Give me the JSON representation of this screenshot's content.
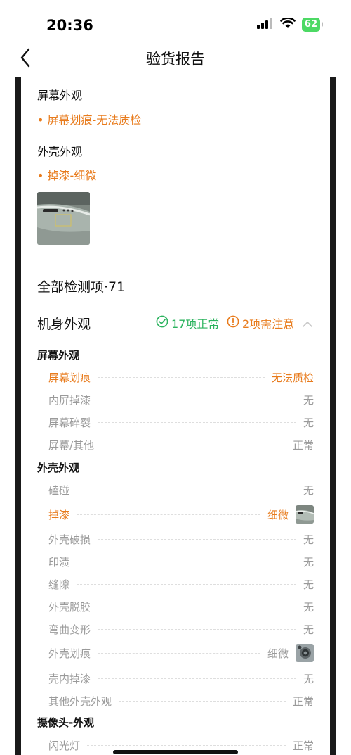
{
  "status": {
    "time": "20:36",
    "battery": "62"
  },
  "nav": {
    "title": "验货报告"
  },
  "issues": [
    {
      "heading": "屏幕外观",
      "item": "• 屏幕划痕-无法质检"
    },
    {
      "heading": "外壳外观",
      "item": "• 掉漆-细微"
    }
  ],
  "all_items_title": "全部检测项·71",
  "section": {
    "title": "机身外观",
    "ok_badge": "17项正常",
    "warn_badge": "2项需注意"
  },
  "groups": [
    {
      "title": "屏幕外观",
      "rows": [
        {
          "label": "屏幕划痕",
          "value": "无法质检",
          "warn": true
        },
        {
          "label": "内屏掉漆",
          "value": "无"
        },
        {
          "label": "屏幕碎裂",
          "value": "无"
        },
        {
          "label": "屏幕/其他",
          "value": "正常"
        }
      ]
    },
    {
      "title": "外壳外观",
      "rows": [
        {
          "label": "磕碰",
          "value": "无"
        },
        {
          "label": "掉漆",
          "value": "细微",
          "warn": true,
          "thumb": true
        },
        {
          "label": "外壳破损",
          "value": "无"
        },
        {
          "label": "印渍",
          "value": "无"
        },
        {
          "label": "缝隙",
          "value": "无"
        },
        {
          "label": "外壳脱胶",
          "value": "无"
        },
        {
          "label": "弯曲变形",
          "value": "无"
        },
        {
          "label": "外壳划痕",
          "value": "细微",
          "thumb": true
        },
        {
          "label": "壳内掉漆",
          "value": "无"
        },
        {
          "label": "其他外壳外观",
          "value": "正常"
        }
      ]
    },
    {
      "title": "摄像头-外观",
      "rows": [
        {
          "label": "闪光灯",
          "value": "正常"
        }
      ]
    }
  ],
  "colors": {
    "warning": "#e87b1c",
    "ok": "#2bb35e",
    "muted": "#9a9a9a"
  }
}
